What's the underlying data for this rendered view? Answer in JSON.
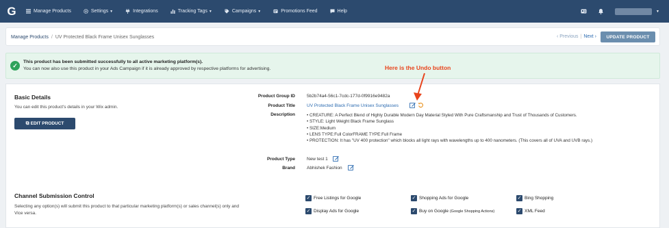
{
  "nav": {
    "logo": "G",
    "items": [
      {
        "label": "Manage Products",
        "icon": "list-icon",
        "has_caret": false
      },
      {
        "label": "Settings",
        "icon": "gear-icon",
        "has_caret": true
      },
      {
        "label": "Integrations",
        "icon": "plug-icon",
        "has_caret": false
      },
      {
        "label": "Tracking Tags",
        "icon": "chart-icon",
        "has_caret": true
      },
      {
        "label": "Campaigns",
        "icon": "tag-icon",
        "has_caret": true
      },
      {
        "label": "Promotions Feed",
        "icon": "megaphone-icon",
        "has_caret": false
      },
      {
        "label": "Help",
        "icon": "chat-icon",
        "has_caret": false
      }
    ],
    "colors": {
      "bar": "#2c4a6e"
    }
  },
  "breadcrumb": {
    "root": "Manage Products",
    "separator": "/",
    "current": "UV Protected Black Frame Unisex Sunglasses"
  },
  "pager": {
    "previous": "‹ Previous",
    "divider": "|",
    "next": "Next ›"
  },
  "update_button": "UPDATE PRODUCT",
  "alert": {
    "line1": "This product has been submitted successfully to all active marketing platform(s).",
    "line2": "You can now also use this product in your Ads Campaign if it is already approved by respective platforms for advertising.",
    "color": "#2fa35b"
  },
  "annotation": {
    "text": "Here is the Undo button",
    "color": "#e8431b"
  },
  "basic_details": {
    "title": "Basic Details",
    "description": "You can edit this product's details in your Wix admin.",
    "edit_button": "EDIT PRODUCT"
  },
  "product": {
    "group_id_label": "Product Group ID",
    "group_id": "5b2b74a4-56c1-7cdc-177d-0f9916e9482a",
    "title_label": "Product Title",
    "title": "UV Protected Black Frame Unisex Sunglasses",
    "description_label": "Description",
    "description_items": [
      "CREATURE: A Perfect Blend of Highly Durable Modern Day Material Styled With Pure Craftsmanship and Trust of Thousands of Customers.",
      "STYLE: Light Weight Black Frame Sunglass",
      "SIZE:Medium",
      "LENS TYPE:Full ColorFRAME TYPE:Full Frame",
      "PROTECTION: It has \"UV 400 protection\" which blocks all light rays with wavelengths up to 400 nanometers. (This covers all of UVA and UVB rays.)"
    ],
    "type_label": "Product Type",
    "type": "New test 1",
    "brand_label": "Brand",
    "brand": "Abhishek Fashion"
  },
  "channel": {
    "title": "Channel Submission Control",
    "description": "Selecting any option(s) will submit this product to that particular marketing platform(s) or sales channel(s) only and Vice versa.",
    "options": [
      {
        "label": "Free Listings for Google",
        "checked": true
      },
      {
        "label": "Shopping Ads for Google",
        "checked": true
      },
      {
        "label": "Bing Shopping",
        "checked": true
      },
      {
        "label": "Display Ads for Google",
        "checked": true
      },
      {
        "label": "Buy on Google",
        "note": "(Google Shopping Actions)",
        "checked": true
      },
      {
        "label": "XML Feed",
        "checked": true
      }
    ]
  }
}
